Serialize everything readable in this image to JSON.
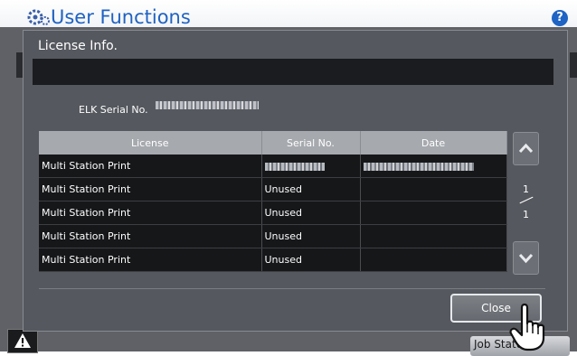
{
  "app": {
    "title": "User Functions",
    "help_label": "?"
  },
  "dialog": {
    "title": "License Info.",
    "elk_label": "ELK Serial No.",
    "elk_value_obscured": true,
    "table": {
      "headers": [
        "License",
        "Serial No.",
        "Date"
      ],
      "rows": [
        {
          "license": "Multi Station Print",
          "serial": "",
          "date": ""
        },
        {
          "license": "Multi Station Print",
          "serial": "Unused",
          "date": ""
        },
        {
          "license": "Multi Station Print",
          "serial": "Unused",
          "date": ""
        },
        {
          "license": "Multi Station Print",
          "serial": "Unused",
          "date": ""
        },
        {
          "license": "Multi Station Print",
          "serial": "Unused",
          "date": ""
        }
      ]
    },
    "pagination": {
      "current": "1",
      "total": "1"
    },
    "close_label": "Close"
  },
  "background": {
    "jobs_label": "Job Status"
  },
  "icons": {
    "gear": "gear-icon",
    "help": "help-icon",
    "warning": "warning-icon",
    "up": "chevron-up-icon",
    "down": "chevron-down-icon",
    "pointer": "hand-pointer-icon"
  },
  "colors": {
    "title_blue": "#1f62c2",
    "header_gray": "#a6a9ae",
    "cell_bg": "#161719",
    "dialog_bg": "#55585e"
  }
}
